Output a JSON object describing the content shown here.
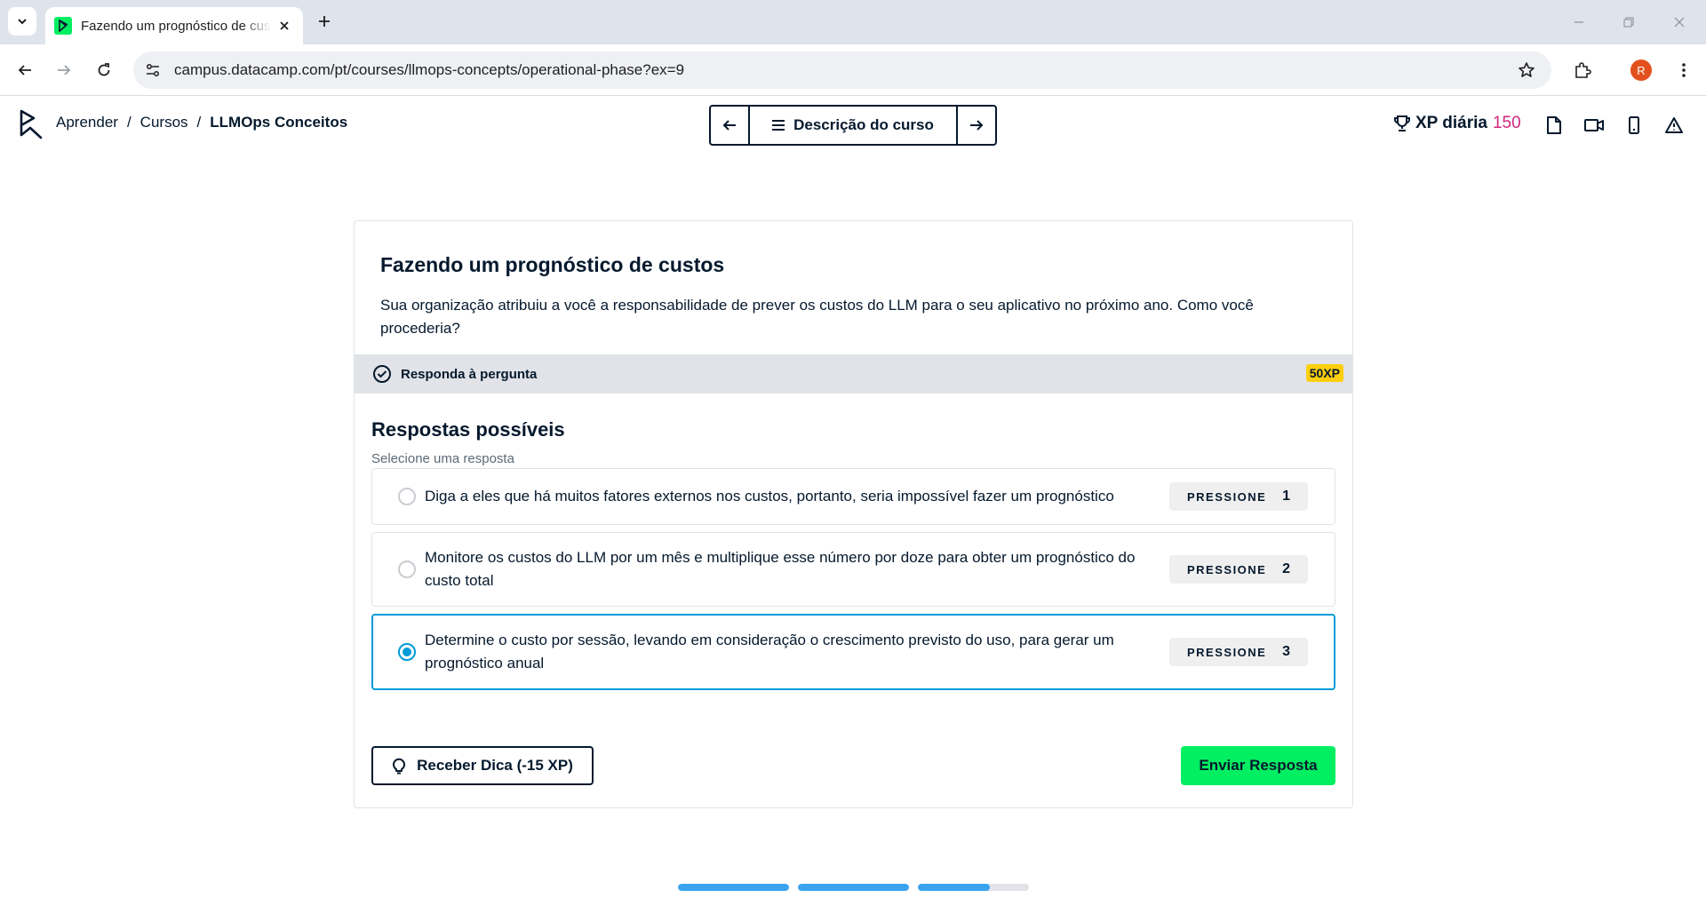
{
  "browser": {
    "tab_title": "Fazendo um prognóstico de custos",
    "url": "campus.datacamp.com/pt/courses/llmops-concepts/operational-phase?ex=9",
    "profile_initial": "R"
  },
  "header": {
    "breadcrumb": [
      "Aprender",
      "Cursos",
      "LLMOps Conceitos"
    ],
    "breadcrumb_sep": "/",
    "course_description_label": "Descrição do curso",
    "xp_label": "XP diária",
    "xp_value": "150"
  },
  "exercise": {
    "title": "Fazendo um prognóstico de custos",
    "description": "Sua organização atribuiu a você a responsabilidade de prever os custos do LLM para o seu aplicativo no próximo ano. Como você procederia?",
    "task_label": "Responda à pergunta",
    "xp_badge": "50XP",
    "answers_title": "Respostas possíveis",
    "answers_subtitle": "Selecione uma resposta",
    "options": [
      {
        "text": "Diga a eles que há muitos fatores externos nos custos, portanto, seria impossível fazer um prognóstico",
        "key_label": "PRESSIONE",
        "key": "1",
        "selected": false
      },
      {
        "text": "Monitore os custos do LLM por um mês e multiplique esse número por doze para obter um prognóstico do custo total",
        "key_label": "PRESSIONE",
        "key": "2",
        "selected": false
      },
      {
        "text": "Determine o custo por sessão, levando em consideração o crescimento previsto do uso, para gerar um prognóstico anual",
        "key_label": "PRESSIONE",
        "key": "3",
        "selected": true
      }
    ],
    "hint_button": "Receber Dica (-15 XP)",
    "submit_button": "Enviar Resposta"
  },
  "progress": [
    1,
    1,
    0.65
  ],
  "colors": {
    "brand_green": "#03ef62",
    "selected_blue": "#009bd8",
    "xp_pink": "#d1267d",
    "badge_yellow": "#fcce0d",
    "progress_blue": "#3aa3f0"
  }
}
